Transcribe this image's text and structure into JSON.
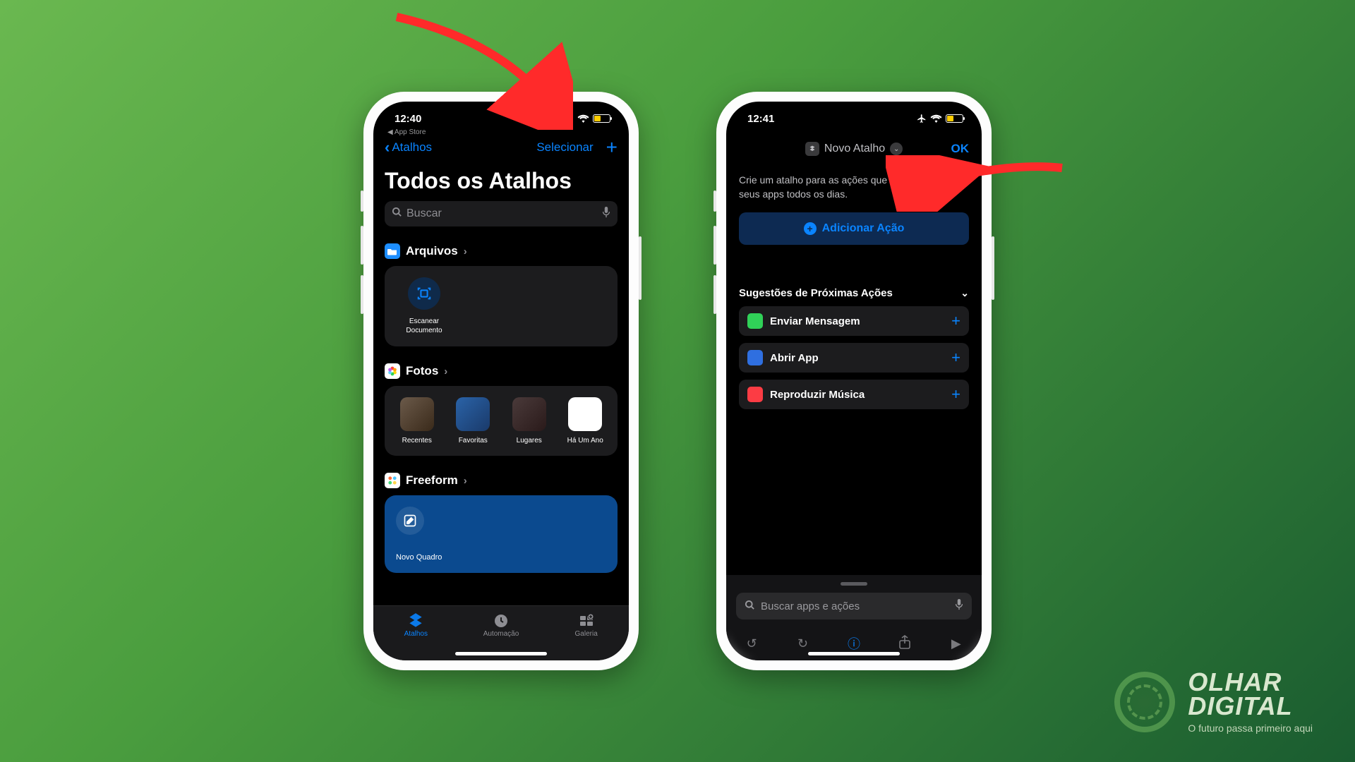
{
  "phone1": {
    "status": {
      "time": "12:40",
      "back_app": "◀ App Store",
      "battery_pct": 38
    },
    "nav": {
      "back_label": "Atalhos",
      "select_label": "Selecionar"
    },
    "title": "Todos os Atalhos",
    "search_placeholder": "Buscar",
    "sections": {
      "arquivos": {
        "label": "Arquivos",
        "scan_label": "Escanear\nDocumento"
      },
      "fotos": {
        "label": "Fotos",
        "items": [
          {
            "label": "Recentes"
          },
          {
            "label": "Favoritas"
          },
          {
            "label": "Lugares"
          },
          {
            "label": "Há Um Ano"
          }
        ]
      },
      "freeform": {
        "label": "Freeform",
        "tile_label": "Novo Quadro"
      }
    },
    "tabs": [
      {
        "label": "Atalhos",
        "active": true
      },
      {
        "label": "Automação",
        "active": false
      },
      {
        "label": "Galeria",
        "active": false
      }
    ]
  },
  "phone2": {
    "status": {
      "time": "12:41",
      "battery_pct": 38
    },
    "nav": {
      "title": "Novo Atalho",
      "ok": "OK"
    },
    "hint": "Crie um atalho para as ações que você realiza nos seus apps todos os dias.",
    "add_action": "Adicionar Ação",
    "suggestions_header": "Sugestões de Próximas Ações",
    "suggestions": [
      {
        "label": "Enviar Mensagem",
        "color": "#30d158"
      },
      {
        "label": "Abrir App",
        "color": "#2f6fe0"
      },
      {
        "label": "Reproduzir Música",
        "color": "#fc3c44"
      }
    ],
    "bottom_search_placeholder": "Buscar apps e ações"
  },
  "brand": {
    "line1": "OLHAR",
    "line2": "DIGITAL",
    "tagline": "O futuro passa primeiro aqui"
  }
}
